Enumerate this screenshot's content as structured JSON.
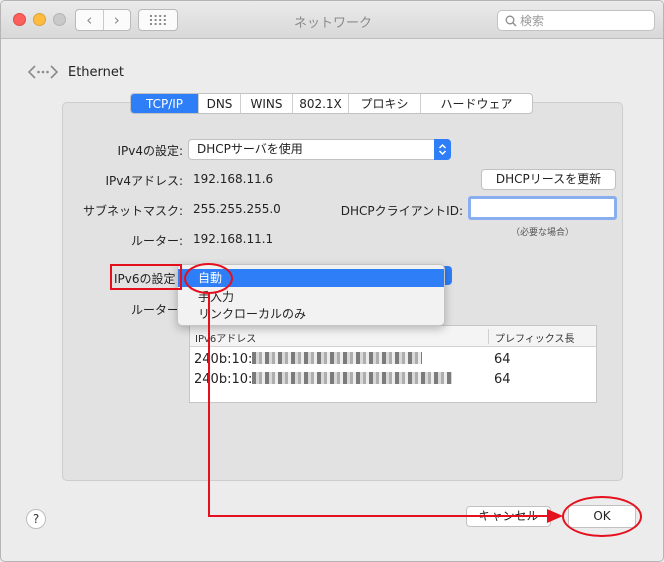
{
  "window": {
    "title": "ネットワーク"
  },
  "toolbar": {
    "back_icon": "‹",
    "forward_icon": "›",
    "search_placeholder": "検索"
  },
  "interface": {
    "name": "Ethernet"
  },
  "tabs": [
    {
      "label": "TCP/IP",
      "active": true
    },
    {
      "label": "DNS",
      "active": false
    },
    {
      "label": "WINS",
      "active": false
    },
    {
      "label": "802.1X",
      "active": false
    },
    {
      "label": "プロキシ",
      "active": false
    },
    {
      "label": "ハードウェア",
      "active": false
    }
  ],
  "ipv4": {
    "config_label": "IPv4の設定:",
    "config_value": "DHCPサーバを使用",
    "address_label": "IPv4アドレス:",
    "address_value": "192.168.11.6",
    "subnet_label": "サブネットマスク:",
    "subnet_value": "255.255.255.0",
    "router_label": "ルーター:",
    "router_value": "192.168.11.1",
    "renew_button": "DHCPリースを更新",
    "client_id_label": "DHCPクライアントID:",
    "client_id_value": "",
    "client_id_hint": "（必要な場合）"
  },
  "ipv6": {
    "config_label": "IPv6の設定",
    "router_label": "ルーター",
    "dropdown_options": [
      "自動",
      "手入力",
      "リンクローカルのみ"
    ],
    "table_headers": [
      "IPv6アドレス",
      "プレフィックス長"
    ],
    "rows": [
      {
        "address_prefix": "240b:10:",
        "prefix_length": "64"
      },
      {
        "address_prefix": "240b:10:",
        "prefix_length": "64"
      }
    ]
  },
  "footer": {
    "help": "?",
    "cancel_button": "キャンセル",
    "ok_button": "OK"
  },
  "colors": {
    "accent": "#2e7ef7",
    "annotation": "#e5101d"
  }
}
